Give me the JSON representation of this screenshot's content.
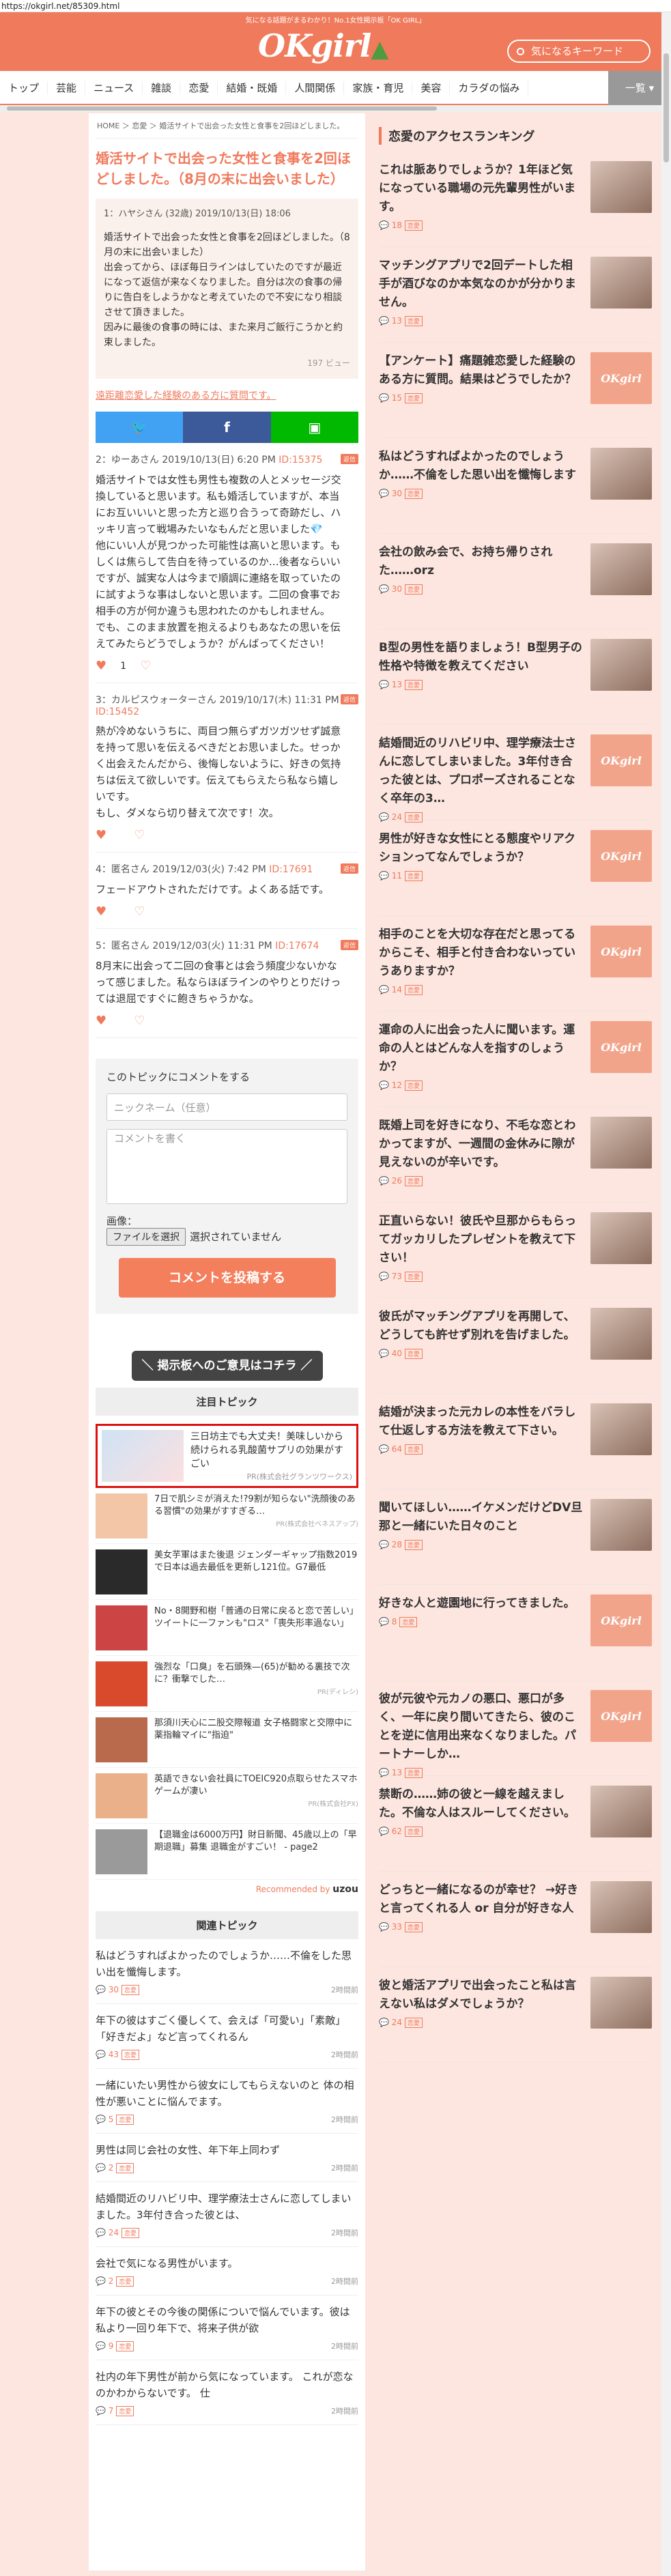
{
  "url": "https://okgirl.net/85309.html",
  "header": {
    "tagline": "気になる話題がまるわかり！No.1女性掲示板「OK GIRL」",
    "logo": "OKgirl",
    "search_placeholder": "気になるキーワード"
  },
  "nav": {
    "items": [
      "トップ",
      "芸能",
      "ニュース",
      "雑談",
      "恋愛",
      "結婚・既婚",
      "人間関係",
      "家族・育児",
      "美容",
      "カラダの悩み"
    ],
    "more": "一覧"
  },
  "breadcrumb": [
    "HOME",
    "恋愛",
    "婚活サイトで出会った女性と食事を2回ほどしました。"
  ],
  "topic": {
    "title": "婚活サイトで出会った女性と食事を2回ほどしました。（8月の末に出会いました）",
    "header": "1：ハヤシさん (32歳) 2019/10/13(日) 18:06",
    "body": "婚活サイトで出会った女性と食事を2回ほどしました。（8月の末に出会いました）\n出会ってから、ほぼ毎日ラインはしていたのですが最近になって返信が来なくなりました。自分は次の食事の帰りに告白をしようかなと考えていたので不安になり相談させて頂きました。\n因みに最後の食事の時には、また来月ご飯行こうかと約束しました。",
    "views": "197 ビュー",
    "link": "遠距離恋愛した経験のある方に質問です。"
  },
  "share": {
    "twitter": "twitter-icon",
    "facebook": "f",
    "line": "line-icon"
  },
  "comments": [
    {
      "meta": "2：ゆーあさん 2019/10/13(日) 6:20 PM",
      "id": "ID:15375",
      "badge": "返信",
      "body": "婚活サイトでは女性も男性も複数の人とメッセージ交換していると思います。私も婚活していますが、本当にお互いいいと思った方と巡り合うって奇跡だし、ハッキリ言って戦場みたいなもんだと思いました💎\n他にいい人が見つかった可能性は高いと思います。もしくは焦らして告白を待っているのか…後者ならいいですが、誠実な人は今まで順調に連絡を取っていたのに試すような事はしないと思います。二回の食事でお相手の方が何か違うも思われたのかもしれません。\nでも、このまま放置を抱えるよりもあなたの思いを伝えてみたらどうでしょうか？がんばってください！",
      "plus": "1",
      "minus": ""
    },
    {
      "meta": "3：カルピスウォーターさん 2019/10/17(木) 11:31 PM",
      "id": "ID:15452",
      "badge": "返信",
      "body": "熱が冷めないうちに、両目つ無らずガツガツせず誠意を持って思いを伝えるべきだとお思いました。せっかく出会えたんだから、後悔しないように、好きの気持ちは伝えて欲しいです。伝えてもらえたら私なら嬉しいです。\nもし、ダメなら切り替えて次です！次。",
      "plus": "",
      "minus": ""
    },
    {
      "meta": "4：匿名さん 2019/12/03(火) 7:42 PM",
      "id": "ID:17691",
      "badge": "返信",
      "body": "フェードアウトされただけです。よくある話です。",
      "plus": "",
      "minus": ""
    },
    {
      "meta": "5：匿名さん 2019/12/03(火) 11:31 PM",
      "id": "ID:17674",
      "badge": "返信",
      "body": "8月末に出会って二回の食事とは会う頻度少ないかなって感じました。私ならほぼラインのやりとりだけっては退屈ですぐに飽きちゃうかな。",
      "plus": "",
      "minus": ""
    }
  ],
  "form": {
    "title": "このトピックにコメントをする",
    "name_placeholder": "ニックネーム（任意）",
    "comment_placeholder": "コメントを書く",
    "image_label": "画像：",
    "file_button": "ファイルを選択",
    "file_status": "選択されていません",
    "submit": "コメントを投稿する"
  },
  "feedback_button": "＼ 掲示板へのご意見はコチラ ／",
  "featured_title": "注目トピック",
  "featured_ad": {
    "text": "三日坊主でも大丈夫！美味しいから続けられる乳酸菌サプリの効果がすごい",
    "source": "PR(株式会社グランツワークス)"
  },
  "ads": [
    {
      "text": "7日で肌シミが消えた!?9割が知らない\"洗顔後のある習慣\"の効果がすすぎる…",
      "source": "PR(株式会社ベネスアップ)",
      "thumb": "#f3c6a8"
    },
    {
      "text": "美女芋軍はまた後退 ジェンダーギャップ指数2019で日本は過去最低を更新し121位。G7最低",
      "source": "",
      "thumb": "#2a2a2a"
    },
    {
      "text": "No・8開野和樹「普通の日常に戻ると恋で苦しい」ツイートに一ファンも\"ロス\"「喪失形率過ない」",
      "source": "",
      "thumb": "#c44"
    },
    {
      "text": "強烈な「口臭」を石頭殊—(65)が勧める裏技で次に？衝撃でした…",
      "source": "PR(ディレシ)",
      "thumb": "#d84a2b"
    },
    {
      "text": "那須川天心に二股交際報道 女子格闘家と交際中に薬指輪マイに\"指迫\"",
      "source": "",
      "thumb": "#b96a4c"
    },
    {
      "text": "英語できない会社員にTOEIC920点取らせたスマホゲームが凄い",
      "source": "PR(株式会社PX)",
      "thumb": "#e9b08a"
    },
    {
      "text": "【退職金は6000万円】財日新聞、45歳以上の「早期退職」募集 退職金がすごい！ - page2",
      "source": "",
      "thumb": "#9a9a9a"
    }
  ],
  "recommended": "Recommended by",
  "recommended_brand": "uzou",
  "related_title": "関連トピック",
  "related": [
    {
      "title": "私はどうすればよかったのでしょうか……不倫をした思い出を懺悔します。",
      "count": "30",
      "time": "2時間前"
    },
    {
      "title": "年下の彼はすごく優しくて、会えば「可愛い」「素敵」「好きだよ」など言ってくれるん",
      "count": "43",
      "time": "2時間前"
    },
    {
      "title": "一緒にいたい男性から彼女にしてもらえないのと 体の相性が悪いことに悩んでます。",
      "count": "5",
      "time": "2時間前"
    },
    {
      "title": "男性は同じ会社の女性、年下年上同わず",
      "count": "2",
      "time": "2時間前"
    },
    {
      "title": "結婚間近のリハビリ中、理学療法士さんに恋してしまいました。3年付き合った彼とは、",
      "count": "24",
      "time": "2時間前"
    },
    {
      "title": "会社で気になる男性がいます。",
      "count": "2",
      "time": "2時間前"
    },
    {
      "title": "年下の彼とその今後の関係についで悩んでいます。彼は私より一回り年下で、将来子供が欲",
      "count": "9",
      "time": "2時間前"
    },
    {
      "title": "社内の年下男性が前から気になっています。 これが恋なのかわからないです。 仕",
      "count": "7",
      "time": "2時間前"
    }
  ],
  "ranking_title": "恋愛のアクセスランキング",
  "ranking": [
    {
      "title": "これは脈ありでしょうか？1年ほど気になっている職場の元先輩男性がいます。",
      "count": "18",
      "thumb": "img"
    },
    {
      "title": "マッチングアプリで2回デートした相手が酒びなのか本気なのかが分かりません。",
      "count": "13",
      "thumb": "img"
    },
    {
      "title": "【アンケート】痛題雑恋愛した経験のある方に質問。結果はどうでしたか？",
      "count": "15",
      "thumb": "logo"
    },
    {
      "title": "私はどうすればよかったのでしょうか……不倫をした思い出を懺悔します",
      "count": "30",
      "thumb": "img"
    },
    {
      "title": "会社の飲み会で、お持ち帰りされた……orz",
      "count": "30",
      "thumb": "img"
    },
    {
      "title": "B型の男性を語りましょう！B型男子の性格や特徴を教えてください",
      "count": "13",
      "thumb": "img"
    },
    {
      "title": "結婚間近のリハビリ中、理学療法士さんに恋してしまいました。3年付き合った彼とは、プロポーズされることなく卒年の3…",
      "count": "24",
      "thumb": "logo"
    },
    {
      "title": "男性が好きな女性にとる態度やリアクションってなんでしょうか？",
      "count": "11",
      "thumb": "logo"
    },
    {
      "title": "相手のことを大切な存在だと思ってるからこそ、相手と付き合わないっていうありますか？",
      "count": "14",
      "thumb": "logo"
    },
    {
      "title": "運命の人に出会った人に聞います。運命の人とはどんな人を指すのしょうか？",
      "count": "12",
      "thumb": "logo"
    },
    {
      "title": "既婚上司を好きになり、不毛な恋とわかってますが、一週間の金休みに隙が見えないのが辛いです。",
      "count": "26",
      "thumb": "img"
    },
    {
      "title": "正直いらない！彼氏や旦那からもらってガッカリしたプレゼントを教えて下さい！",
      "count": "73",
      "thumb": "img"
    },
    {
      "title": "彼氏がマッチングアプリを再開して、どうしても許せず別れを告げました。",
      "count": "40",
      "thumb": "img"
    },
    {
      "title": "結婚が決まった元カレの本性をバラして仕返しする方法を教えて下さい。",
      "count": "64",
      "thumb": "img"
    },
    {
      "title": "聞いてほしい……イケメンだけどDV旦那と一緒にいた日々のこと",
      "count": "28",
      "thumb": "img"
    },
    {
      "title": "好きな人と遊園地に行ってきました。",
      "count": "8",
      "thumb": "logo"
    },
    {
      "title": "彼が元彼や元カノの悪口、悪口が多く、一年に戻り間いてきたら、彼のことを逆に信用出来なくなりました。パートナーしか…",
      "count": "13",
      "thumb": "logo"
    },
    {
      "title": "禁断の……姉の彼と一線を越えました。不倫な人はスルーしてください。",
      "count": "62",
      "thumb": "img"
    },
    {
      "title": "どっちと一緒になるのが幸せ？ →好きと言ってくれる人 or 自分が好きな人",
      "count": "33",
      "thumb": "img"
    },
    {
      "title": "彼と婚活アプリで出会ったこと私は言えない私はダメでしょうか？",
      "count": "24",
      "thumb": "img"
    }
  ],
  "ranking_tag": "恋愛",
  "colors": {
    "brand": "#f07a5c",
    "twitter": "#41a1f2",
    "facebook": "#3c5a99",
    "line": "#00b900"
  }
}
